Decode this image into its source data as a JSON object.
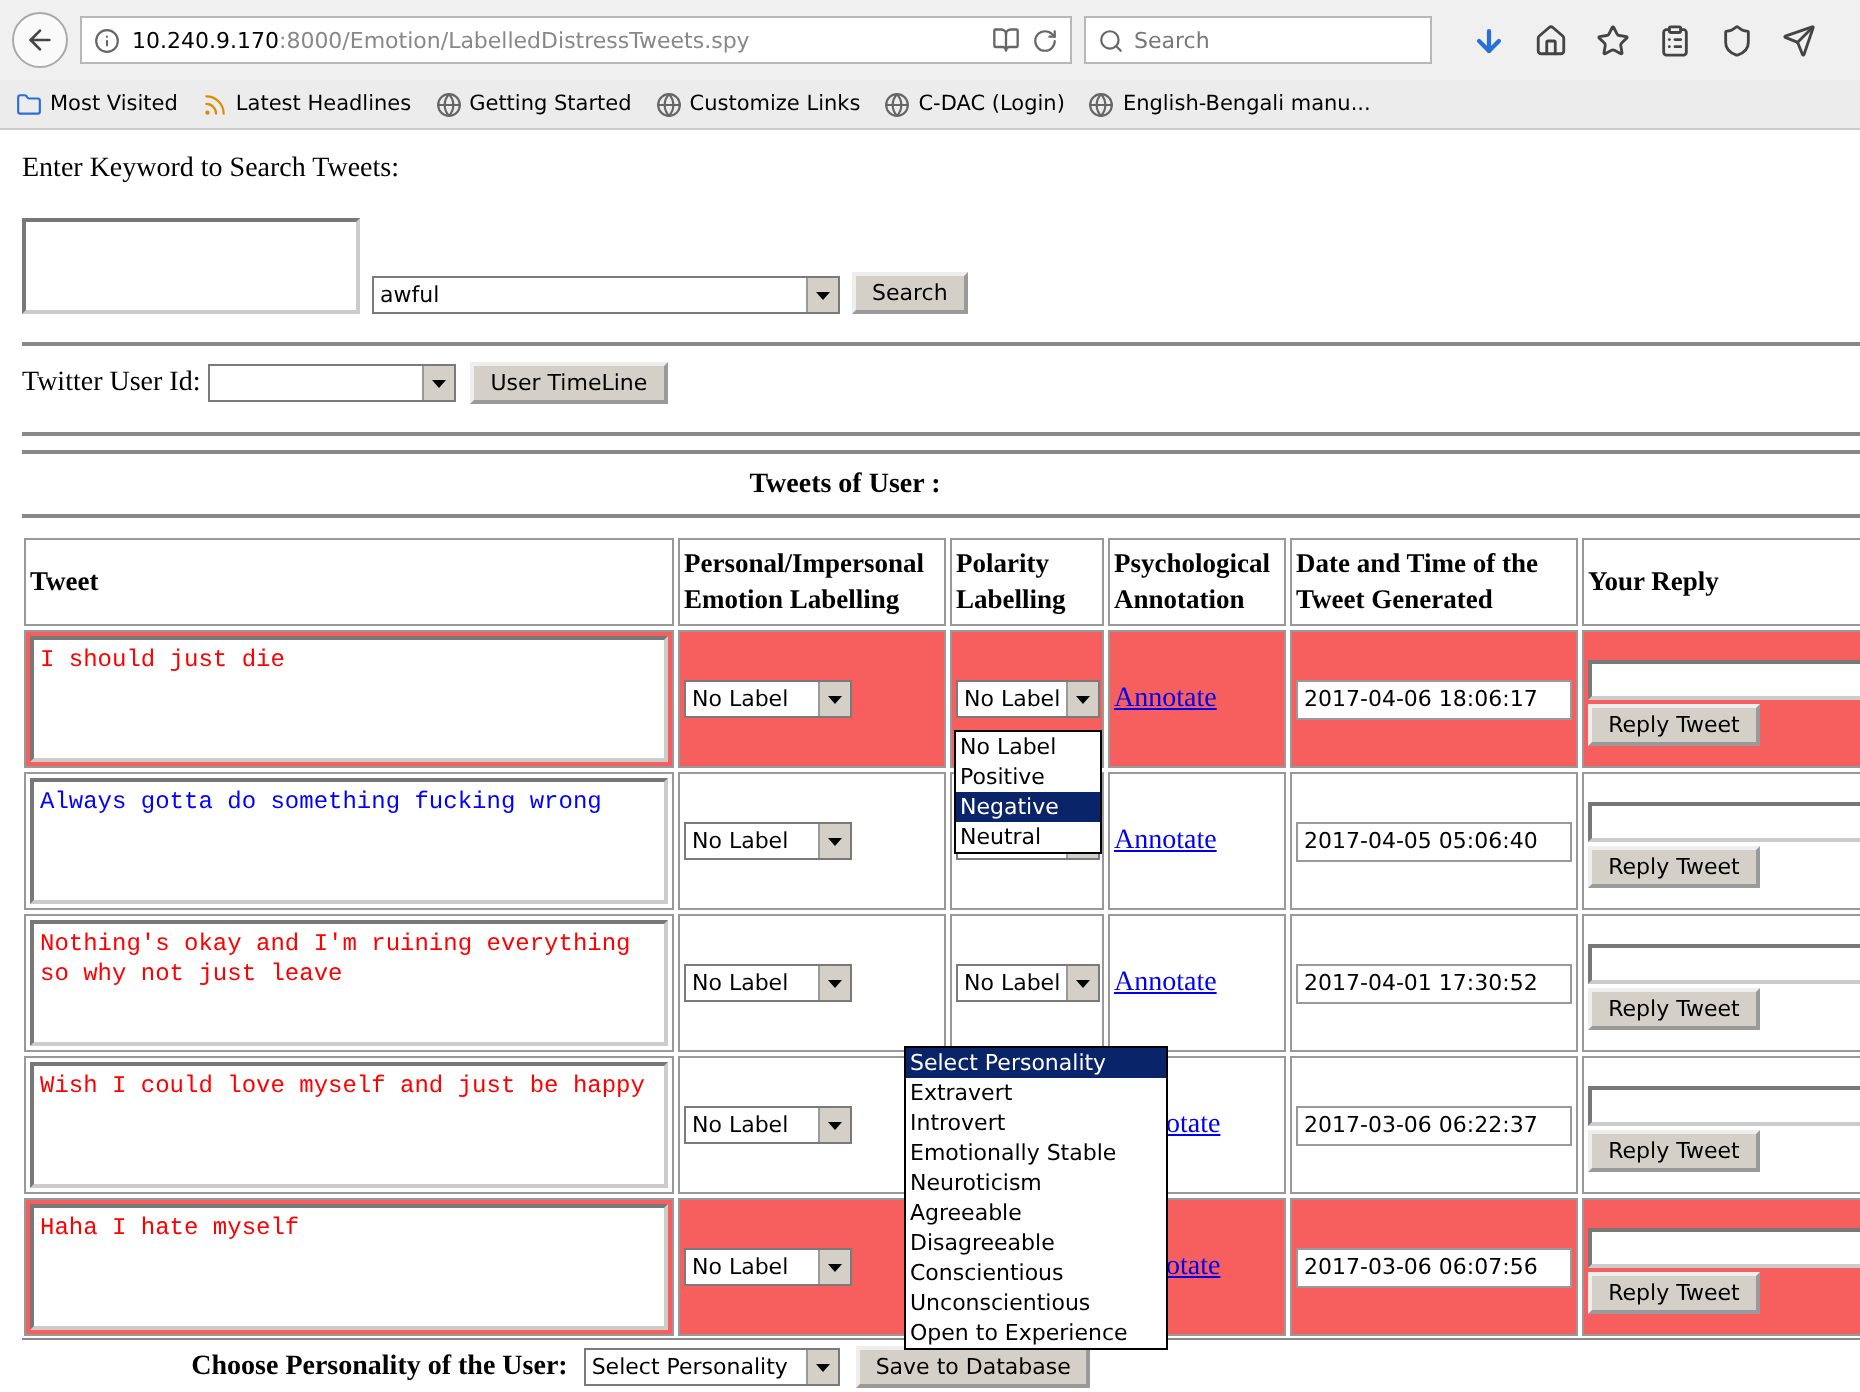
{
  "browser": {
    "url_host": "10.240.9.170",
    "url_path": ":8000/Emotion/LabelledDistressTweets.spy",
    "search_placeholder": "Search",
    "bookmarks": [
      {
        "label": "Most Visited",
        "kind": "folder"
      },
      {
        "label": "Latest Headlines",
        "kind": "feed"
      },
      {
        "label": "Getting Started",
        "kind": "globe"
      },
      {
        "label": "Customize Links",
        "kind": "globe"
      },
      {
        "label": "C-DAC (Login)",
        "kind": "globe"
      },
      {
        "label": "English-Bengali manu...",
        "kind": "globe"
      }
    ]
  },
  "search_form": {
    "prompt": "Enter Keyword to Search Tweets:",
    "keyword": "awful",
    "button": "Search"
  },
  "user_form": {
    "label": "Twitter User Id:",
    "button": "User TimeLine"
  },
  "heading": "Tweets of User :",
  "table": {
    "columns": [
      "Tweet",
      "Personal/Impersonal Emotion Labelling",
      "Polarity Labelling",
      "Psychological Annotation",
      "Date and Time of the Tweet Generated",
      "Your Reply"
    ],
    "rows": [
      {
        "tweet": "I should just die",
        "color": "#ff0000",
        "highlighted": true,
        "emotion_label": "No Label",
        "polarity_label": "No Label",
        "annotate": "Annotate",
        "date": "2017-04-06 18:06:17",
        "reply_button": "Reply Tweet"
      },
      {
        "tweet": "Always gotta do something fucking wrong",
        "color": "#0000ff",
        "highlighted": false,
        "emotion_label": "No Label",
        "annotate": "Annotate",
        "date": "2017-04-05 05:06:40",
        "reply_button": "Reply Tweet"
      },
      {
        "tweet": "Nothing's okay and I'm ruining everything so why not just leave",
        "color": "#ff0000",
        "highlighted": false,
        "emotion_label": "No Label",
        "polarity_label": "No Label",
        "annotate": "Annotate",
        "date": "2017-04-01 17:30:52",
        "reply_button": "Reply Tweet"
      },
      {
        "tweet": "Wish I could love myself and just be happy",
        "color": "#ff0000",
        "highlighted": false,
        "emotion_label": "No Label",
        "annotate": "otate",
        "date": "2017-03-06 06:22:37",
        "reply_button": "Reply Tweet"
      },
      {
        "tweet": "Haha I hate myself",
        "color": "#ff0000",
        "highlighted": true,
        "emotion_label": "No Label",
        "annotate": "otate",
        "date": "2017-03-06 06:07:56",
        "reply_button": "Reply Tweet"
      }
    ]
  },
  "polarity_menu": {
    "options": [
      {
        "label": "No Label",
        "selected": false
      },
      {
        "label": "Positive",
        "selected": false
      },
      {
        "label": "Negative",
        "selected": true
      },
      {
        "label": "Neutral",
        "selected": false
      }
    ]
  },
  "personality_menu": {
    "options": [
      {
        "label": "Select Personality",
        "selected": true
      },
      {
        "label": "Extravert",
        "selected": false
      },
      {
        "label": "Introvert",
        "selected": false
      },
      {
        "label": "Emotionally Stable",
        "selected": false
      },
      {
        "label": "Neuroticism",
        "selected": false
      },
      {
        "label": "Agreeable",
        "selected": false
      },
      {
        "label": "Disagreeable",
        "selected": false
      },
      {
        "label": "Conscientious",
        "selected": false
      },
      {
        "label": "Unconscientious",
        "selected": false
      },
      {
        "label": "Open to Experience",
        "selected": false
      }
    ]
  },
  "footer": {
    "label": "Choose Personality of the User:",
    "select_value": "Select Personality",
    "button": "Save to Database"
  }
}
